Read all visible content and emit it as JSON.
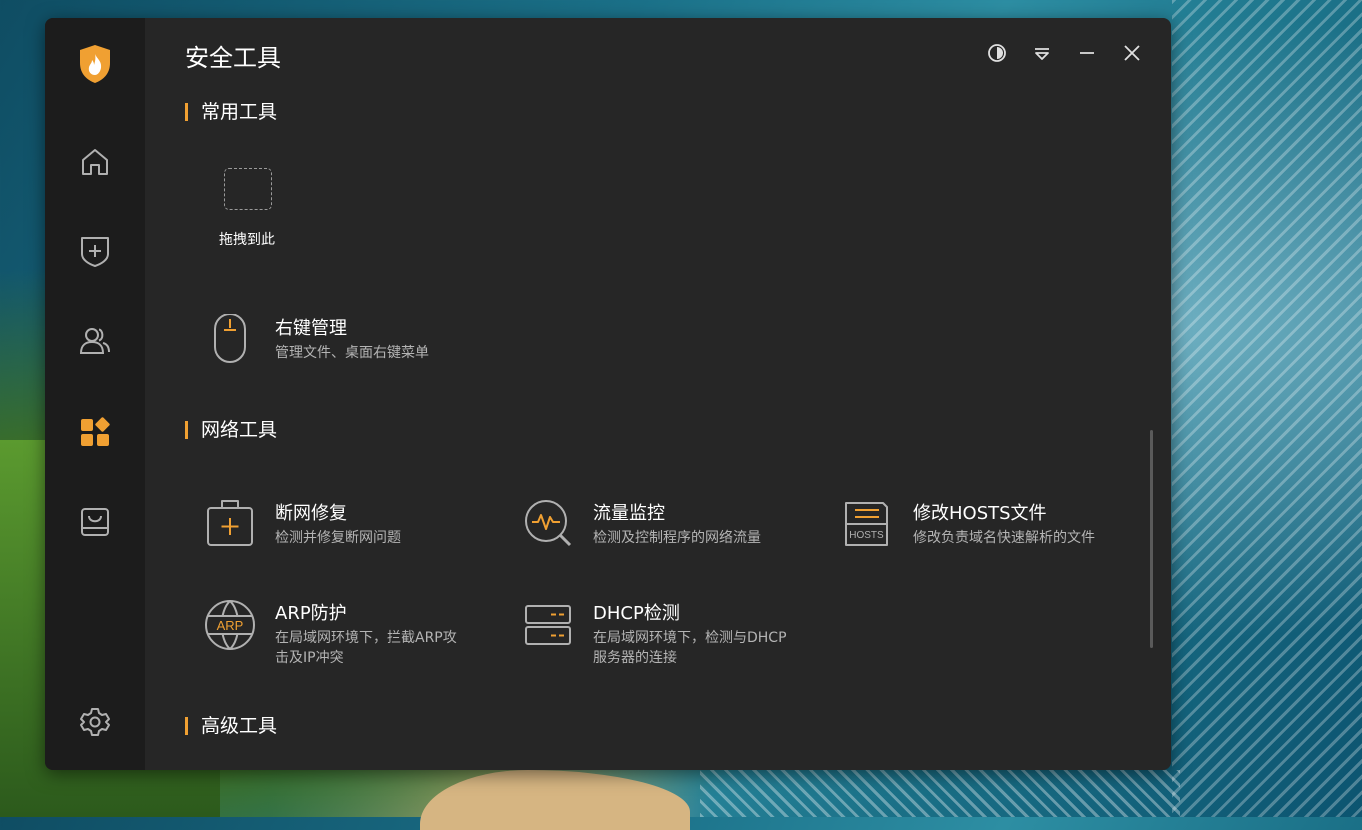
{
  "window": {
    "title": "安全工具"
  },
  "sidebar": {
    "items": [
      {
        "name": "home-icon"
      },
      {
        "name": "shield-plus-icon"
      },
      {
        "name": "users-icon"
      },
      {
        "name": "apps-icon",
        "active": true
      },
      {
        "name": "inbox-tray-icon"
      },
      {
        "name": "settings-gear-icon"
      }
    ]
  },
  "sections": {
    "common": {
      "title": "常用工具",
      "drop_label": "拖拽到此",
      "right_click": {
        "name": "右键管理",
        "desc": "管理文件、桌面右键菜单"
      }
    },
    "network": {
      "title": "网络工具",
      "tools": [
        {
          "name": "断网修复",
          "desc": "检测并修复断网问题",
          "icon": "first-aid-kit-icon"
        },
        {
          "name": "流量监控",
          "desc": "检测及控制程序的网络流量",
          "icon": "traffic-search-icon"
        },
        {
          "name": "修改HOSTS文件",
          "desc": "修改负责域名快速解析的文件",
          "icon": "hosts-folder-icon",
          "icon_text": "HOSTS"
        },
        {
          "name": "ARP防护",
          "desc": "在局域网环境下，拦截ARP攻",
          "desc2": "击及IP冲突",
          "icon": "arp-globe-icon",
          "icon_text": "ARP"
        },
        {
          "name": "DHCP检测",
          "desc": "在局域网环境下，检测与DHCP",
          "desc2": "服务器的连接",
          "icon": "server-icon"
        }
      ]
    },
    "advanced": {
      "title": "高级工具"
    }
  },
  "colors": {
    "accent": "#f0a032",
    "window_bg": "#262626",
    "sidebar_bg": "#1c1c1c",
    "icon_gray": "#b0b0b0"
  }
}
